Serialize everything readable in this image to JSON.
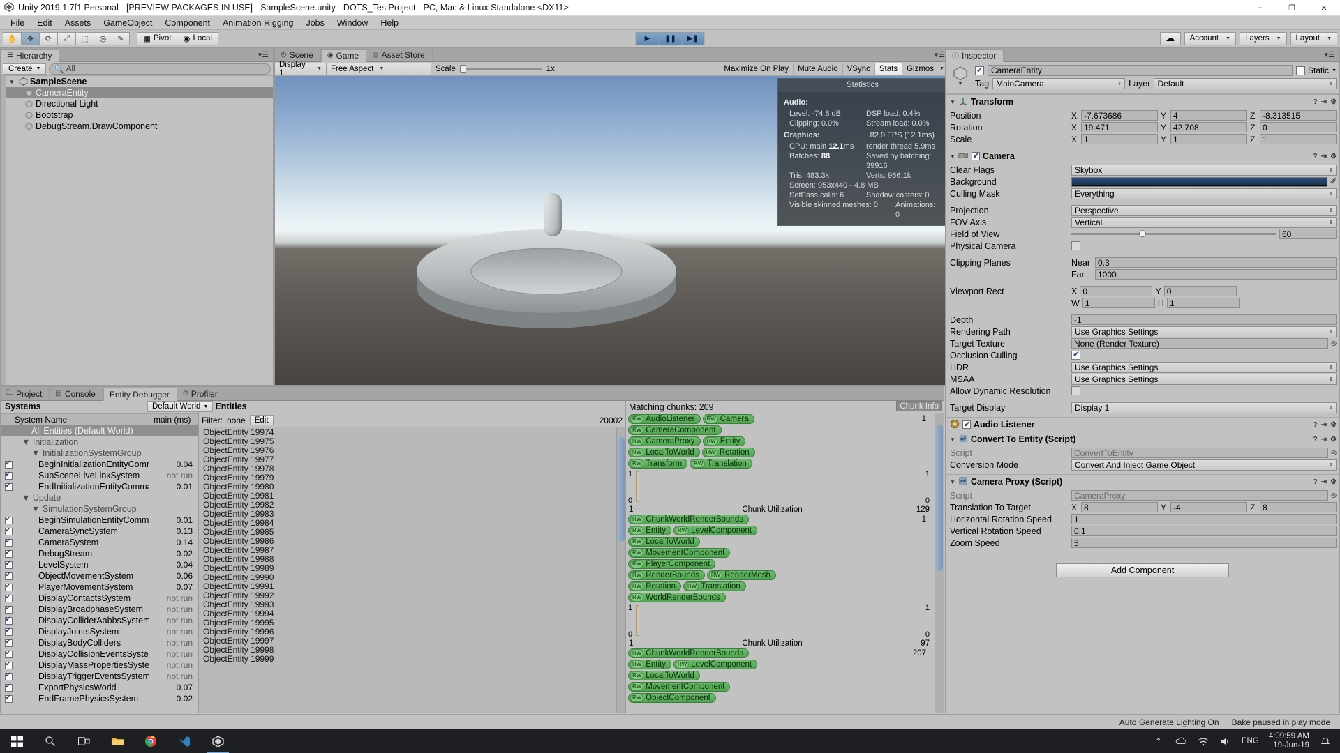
{
  "titlebar": {
    "text": "Unity 2019.1.7f1 Personal - [PREVIEW PACKAGES IN USE] - SampleScene.unity - DOTS_TestProject - PC, Mac & Linux Standalone <DX11>",
    "minimize": "–",
    "maximize": "❐",
    "close": "✕"
  },
  "menubar": [
    "File",
    "Edit",
    "Assets",
    "GameObject",
    "Component",
    "Animation Rigging",
    "Jobs",
    "Window",
    "Help"
  ],
  "toolbar": {
    "tools": [
      "hand-tool",
      "move-tool",
      "rotate-tool",
      "scale-tool",
      "rect-tool",
      "transform-tool",
      "custom-tool"
    ],
    "pivot": "Pivot",
    "local": "Local",
    "play": "▶",
    "pause": "❚❚",
    "step": "▶❚",
    "cloud": "☁",
    "account": "Account",
    "layers": "Layers",
    "layout": "Layout"
  },
  "hierarchy": {
    "tab": "Hierarchy",
    "create": "Create",
    "search_placeholder": "All",
    "items": [
      {
        "label": "SampleScene",
        "depth": 0,
        "type": "scene",
        "selected": false
      },
      {
        "label": "CameraEntity",
        "depth": 1,
        "type": "object",
        "selected": true
      },
      {
        "label": "Directional Light",
        "depth": 1,
        "type": "object",
        "selected": false
      },
      {
        "label": "Bootstrap",
        "depth": 1,
        "type": "object",
        "selected": false
      },
      {
        "label": "DebugStream.DrawComponent",
        "depth": 1,
        "type": "object",
        "selected": false
      }
    ]
  },
  "gameview": {
    "tabs": [
      {
        "label": "Scene",
        "active": false,
        "icon": "scene-icon"
      },
      {
        "label": "Game",
        "active": true,
        "icon": "game-icon"
      },
      {
        "label": "Asset Store",
        "active": false,
        "icon": "store-icon"
      }
    ],
    "display": "Display 1",
    "aspect": "Free Aspect",
    "scale_label": "Scale",
    "scale_value": "1x",
    "maximize_on_play": "Maximize On Play",
    "mute_audio": "Mute Audio",
    "vsync": "VSync",
    "stats": "Stats",
    "gizmos": "Gizmos"
  },
  "statistics": {
    "title": "Statistics",
    "audio_heading": "Audio:",
    "audio": [
      {
        "left": "Level: -74.8 dB",
        "right": "DSP load: 0.4%"
      },
      {
        "left": "Clipping: 0.0%",
        "right": "Stream load: 0.0%"
      }
    ],
    "graphics_heading": "Graphics:",
    "fps": "82.9 FPS (12.1ms)",
    "graphics": [
      {
        "left_pre": "CPU: main ",
        "left_bold": "12.1",
        "left_post": "ms",
        "right": "render thread 5.9ms"
      },
      {
        "left_pre": "Batches: ",
        "left_bold": "88",
        "left_post": "",
        "right": "Saved by batching: 39916"
      },
      {
        "left_pre": "Tris: 483.3k",
        "left_bold": "",
        "left_post": "",
        "right": "Verts: 966.1k"
      }
    ],
    "screen": "Screen: 953x440 - 4.8 MB",
    "setpass": "SetPass calls: 6",
    "shadow_casters": "Shadow casters: 0",
    "visible_skinned": "Visible skinned meshes: 0",
    "animations": "Animations: 0"
  },
  "inspector": {
    "tab": "Inspector",
    "object_name": "CameraEntity",
    "static_label": "Static",
    "tag_label": "Tag",
    "tag_value": "MainCamera",
    "layer_label": "Layer",
    "layer_value": "Default",
    "components": [
      {
        "name": "Transform",
        "icon": "transform-icon",
        "has_checkbox": false,
        "rows": [
          {
            "label": "Position",
            "type": "xyz",
            "x": "-7.673686",
            "y": "4",
            "z": "-8.313515"
          },
          {
            "label": "Rotation",
            "type": "xyz",
            "x": "19.471",
            "y": "42.708",
            "z": "0"
          },
          {
            "label": "Scale",
            "type": "xyz",
            "x": "1",
            "y": "1",
            "z": "1"
          }
        ]
      },
      {
        "name": "Camera",
        "icon": "camera-icon",
        "has_checkbox": true,
        "checked": true,
        "rows": [
          {
            "label": "Clear Flags",
            "type": "dropdown",
            "value": "Skybox"
          },
          {
            "label": "Background",
            "type": "color",
            "value": "#24406b"
          },
          {
            "label": "Culling Mask",
            "type": "dropdown",
            "value": "Everything"
          },
          {
            "label": "",
            "type": "gap"
          },
          {
            "label": "Projection",
            "type": "dropdown",
            "value": "Perspective"
          },
          {
            "label": "FOV Axis",
            "type": "dropdown",
            "value": "Vertical"
          },
          {
            "label": "Field of View",
            "type": "slider",
            "value": "60"
          },
          {
            "label": "Physical Camera",
            "type": "checkbox",
            "checked": false
          },
          {
            "label": "",
            "type": "gap"
          },
          {
            "label": "Clipping Planes",
            "type": "pair",
            "k1": "Near",
            "v1": "0.3",
            "k2": "Far",
            "v2": "1000"
          },
          {
            "label": "",
            "type": "gap"
          },
          {
            "label": "Viewport Rect",
            "type": "rect",
            "k1": "X",
            "v1": "0",
            "k2": "Y",
            "v2": "0",
            "k3": "W",
            "v3": "1",
            "k4": "H",
            "v4": "1"
          },
          {
            "label": "",
            "type": "gap"
          },
          {
            "label": "Depth",
            "type": "text",
            "value": "-1"
          },
          {
            "label": "Rendering Path",
            "type": "dropdown",
            "value": "Use Graphics Settings"
          },
          {
            "label": "Target Texture",
            "type": "object",
            "value": "None (Render Texture)"
          },
          {
            "label": "Occlusion Culling",
            "type": "checkbox",
            "checked": true
          },
          {
            "label": "HDR",
            "type": "dropdown",
            "value": "Use Graphics Settings"
          },
          {
            "label": "MSAA",
            "type": "dropdown",
            "value": "Use Graphics Settings"
          },
          {
            "label": "Allow Dynamic Resolution",
            "type": "checkbox",
            "checked": false
          },
          {
            "label": "",
            "type": "gap"
          },
          {
            "label": "Target Display",
            "type": "dropdown",
            "value": "Display 1"
          }
        ]
      },
      {
        "name": "Audio Listener",
        "icon": "audio-listener-icon",
        "has_checkbox": true,
        "checked": true,
        "rows": []
      },
      {
        "name": "Convert To Entity (Script)",
        "icon": "cs-script-icon",
        "has_checkbox": false,
        "rows": [
          {
            "label": "Script",
            "type": "script",
            "value": "ConvertToEntity"
          },
          {
            "label": "Conversion Mode",
            "type": "dropdown",
            "value": "Convert And Inject Game Object"
          }
        ]
      },
      {
        "name": "Camera Proxy (Script)",
        "icon": "cs-script-icon",
        "has_checkbox": false,
        "rows": [
          {
            "label": "Script",
            "type": "script",
            "value": "CameraProxy"
          },
          {
            "label": "Translation To Target",
            "type": "xyz",
            "x": "8",
            "y": "-4",
            "z": "8"
          },
          {
            "label": "Horizontal Rotation Speed",
            "type": "text",
            "value": "1"
          },
          {
            "label": "Vertical Rotation Speed",
            "type": "text",
            "value": "0.1"
          },
          {
            "label": "Zoom Speed",
            "type": "text",
            "value": "5"
          }
        ]
      }
    ],
    "add_component": "Add Component"
  },
  "bottom": {
    "tabs": [
      {
        "label": "Project",
        "active": false,
        "icon": "folder-icon"
      },
      {
        "label": "Console",
        "active": false,
        "icon": "console-icon"
      },
      {
        "label": "Entity Debugger",
        "active": true,
        "icon": ""
      },
      {
        "label": "Profiler",
        "active": false,
        "icon": "stopwatch-icon"
      }
    ],
    "systems_title": "Systems",
    "world_selector": "Default World",
    "col_system_name": "System Name",
    "col_main_ms": "main (ms)",
    "system_rows": [
      {
        "label": "All Entities (Default World)",
        "depth": 1,
        "kind": "header",
        "ms": ""
      },
      {
        "label": "Initialization",
        "depth": 1,
        "kind": "group",
        "ms": ""
      },
      {
        "label": "InitializationSystemGroup",
        "depth": 2,
        "kind": "group",
        "ms": ""
      },
      {
        "label": "BeginInitializationEntityCommandI",
        "depth": 3,
        "kind": "system",
        "ms": "0.04"
      },
      {
        "label": "SubSceneLiveLinkSystem",
        "depth": 3,
        "kind": "system",
        "ms": "not run"
      },
      {
        "label": "EndInitializationEntityCommandBu",
        "depth": 3,
        "kind": "system",
        "ms": "0.01"
      },
      {
        "label": "Update",
        "depth": 1,
        "kind": "group",
        "ms": ""
      },
      {
        "label": "SimulationSystemGroup",
        "depth": 2,
        "kind": "group",
        "ms": ""
      },
      {
        "label": "BeginSimulationEntityCommandBu",
        "depth": 3,
        "kind": "system",
        "ms": "0.01"
      },
      {
        "label": "CameraSyncSystem",
        "depth": 3,
        "kind": "system",
        "ms": "0.13"
      },
      {
        "label": "CameraSystem",
        "depth": 3,
        "kind": "system",
        "ms": "0.14"
      },
      {
        "label": "DebugStream",
        "depth": 3,
        "kind": "system",
        "ms": "0.02"
      },
      {
        "label": "LevelSystem",
        "depth": 3,
        "kind": "system",
        "ms": "0.04"
      },
      {
        "label": "ObjectMovementSystem",
        "depth": 3,
        "kind": "system",
        "ms": "0.06"
      },
      {
        "label": "PlayerMovementSystem",
        "depth": 3,
        "kind": "system",
        "ms": "0.07"
      },
      {
        "label": "DisplayContactsSystem",
        "depth": 3,
        "kind": "system",
        "ms": "not run"
      },
      {
        "label": "DisplayBroadphaseSystem",
        "depth": 3,
        "kind": "system",
        "ms": "not run"
      },
      {
        "label": "DisplayColliderAabbsSystem",
        "depth": 3,
        "kind": "system",
        "ms": "not run"
      },
      {
        "label": "DisplayJointsSystem",
        "depth": 3,
        "kind": "system",
        "ms": "not run"
      },
      {
        "label": "DisplayBodyColliders",
        "depth": 3,
        "kind": "system",
        "ms": "not run"
      },
      {
        "label": "DisplayCollisionEventsSystem",
        "depth": 3,
        "kind": "system",
        "ms": "not run"
      },
      {
        "label": "DisplayMassPropertiesSystem",
        "depth": 3,
        "kind": "system",
        "ms": "not run"
      },
      {
        "label": "DisplayTriggerEventsSystem",
        "depth": 3,
        "kind": "system",
        "ms": "not run"
      },
      {
        "label": "ExportPhysicsWorld",
        "depth": 3,
        "kind": "system",
        "ms": "0.07"
      },
      {
        "label": "EndFramePhysicsSystem",
        "depth": 3,
        "kind": "system",
        "ms": "0.02"
      }
    ],
    "entities_title": "All Entities",
    "filter_label": "Filter:",
    "filter_value": "none",
    "edit_label": "Edit",
    "entity_count": "20002",
    "entity_rows": [
      "ObjectEntity 19974",
      "ObjectEntity 19975",
      "ObjectEntity 19976",
      "ObjectEntity 19977",
      "ObjectEntity 19978",
      "ObjectEntity 19979",
      "ObjectEntity 19980",
      "ObjectEntity 19981",
      "ObjectEntity 19982",
      "ObjectEntity 19983",
      "ObjectEntity 19984",
      "ObjectEntity 19985",
      "ObjectEntity 19986",
      "ObjectEntity 19987",
      "ObjectEntity 19988",
      "ObjectEntity 19989",
      "ObjectEntity 19990",
      "ObjectEntity 19991",
      "ObjectEntity 19992",
      "ObjectEntity 19993",
      "ObjectEntity 19994",
      "ObjectEntity 19995",
      "ObjectEntity 19996",
      "ObjectEntity 19997",
      "ObjectEntity 19998",
      "ObjectEntity 19999"
    ],
    "matching_chunks": "Matching chunks: 209",
    "chunk_info_btn": "Chunk Info",
    "archetypes": [
      {
        "count": "1",
        "tag_rows": [
          [
            "AudioListener",
            "Camera"
          ],
          [
            "CameraComponent"
          ],
          [
            "CameraProxy",
            "Entity"
          ],
          [
            "LocalToWorld",
            "Rotation"
          ],
          [
            "Transform",
            "Translation"
          ]
        ],
        "graph": {
          "y_top_left": "1",
          "y_bottom_left": "0",
          "y_top_right": "1",
          "y_bottom_right": "0"
        },
        "caption_left": "1",
        "caption_mid": "Chunk Utilization",
        "caption_right": "129"
      },
      {
        "count": "1",
        "tag_rows": [
          [
            "ChunkWorldRenderBounds"
          ],
          [
            "Entity",
            "LevelComponent"
          ],
          [
            "LocalToWorld"
          ],
          [
            "MovementComponent"
          ],
          [
            "PlayerComponent"
          ],
          [
            "RenderBounds",
            "RenderMesh"
          ],
          [
            "Rotation",
            "Translation"
          ],
          [
            "WorldRenderBounds"
          ]
        ],
        "graph": {
          "y_top_left": "1",
          "y_bottom_left": "0",
          "y_top_right": "1",
          "y_bottom_right": "0"
        },
        "caption_left": "1",
        "caption_mid": "Chunk Utilization",
        "caption_right": "97"
      },
      {
        "count": "207",
        "tag_rows": [
          [
            "ChunkWorldRenderBounds"
          ],
          [
            "Entity",
            "LevelComponent"
          ],
          [
            "LocalToWorld"
          ],
          [
            "MovementComponent"
          ],
          [
            "ObjectComponent"
          ]
        ],
        "graph": {
          "y_top_left": "",
          "y_bottom_left": "",
          "y_top_right": "",
          "y_bottom_right": ""
        },
        "caption_left": "",
        "caption_mid": "",
        "caption_right": ""
      }
    ]
  },
  "statusbar": {
    "lighting": "Auto Generate Lighting On",
    "bake": "Bake paused in play mode"
  },
  "taskbar": {
    "start": "⊞",
    "search": "search-icon",
    "taskview": "task-view-icon",
    "apps": [
      "explorer-icon",
      "chrome-icon",
      "vscode-icon",
      "unity-icon"
    ],
    "tray_chevron": "⌃",
    "tray_network": "network-icon",
    "tray_volume": "volume-icon",
    "language": "ENG",
    "time": "4:09:59 AM",
    "date": "19-Jun-19",
    "notification": "notification-icon"
  }
}
